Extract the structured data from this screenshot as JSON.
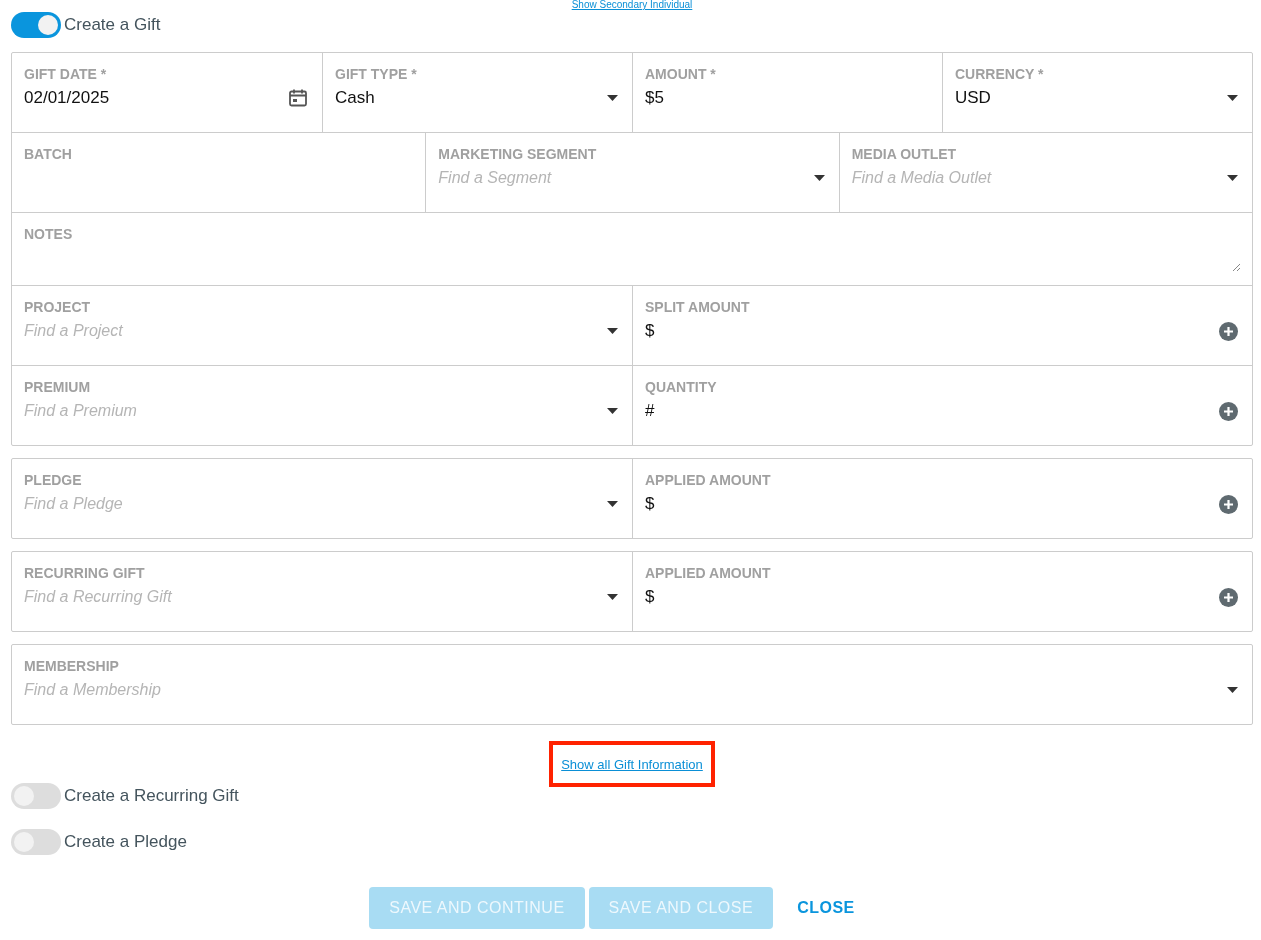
{
  "top_link": {
    "label": "Show Secondary Individual"
  },
  "create_gift": {
    "label": "Create a Gift",
    "on": true
  },
  "groups": [
    {
      "lines": [
        {
          "fields": [
            {
              "kind": "date",
              "label": "GIFT DATE *",
              "value": "02/01/2025"
            },
            {
              "kind": "select",
              "label": "GIFT TYPE *",
              "value": "Cash"
            },
            {
              "kind": "text",
              "label": "AMOUNT *",
              "value": "$5"
            },
            {
              "kind": "select",
              "label": "CURRENCY *",
              "value": "USD"
            }
          ]
        },
        {
          "fields": [
            {
              "kind": "text",
              "label": "BATCH"
            },
            {
              "kind": "select",
              "label": "MARKETING SEGMENT",
              "placeholder": "Find a Segment"
            },
            {
              "kind": "select",
              "label": "MEDIA OUTLET",
              "placeholder": "Find a Media Outlet"
            }
          ]
        },
        {
          "fields": [
            {
              "kind": "textarea",
              "label": "NOTES"
            }
          ]
        },
        {
          "fields": [
            {
              "kind": "select",
              "label": "PROJECT",
              "placeholder": "Find a Project"
            },
            {
              "kind": "add",
              "label": "SPLIT AMOUNT",
              "value": "$"
            }
          ]
        },
        {
          "fields": [
            {
              "kind": "select",
              "label": "PREMIUM",
              "placeholder": "Find a Premium"
            },
            {
              "kind": "add",
              "label": "QUANTITY",
              "value": "#"
            }
          ]
        }
      ]
    },
    {
      "lines": [
        {
          "fields": [
            {
              "kind": "select",
              "label": "PLEDGE",
              "placeholder": "Find a Pledge"
            },
            {
              "kind": "add",
              "label": "APPLIED AMOUNT",
              "value": "$"
            }
          ]
        }
      ]
    },
    {
      "lines": [
        {
          "fields": [
            {
              "kind": "select",
              "label": "RECURRING GIFT",
              "placeholder": "Find a Recurring Gift"
            },
            {
              "kind": "add",
              "label": "APPLIED AMOUNT",
              "value": "$"
            }
          ]
        }
      ]
    },
    {
      "lines": [
        {
          "fields": [
            {
              "kind": "select",
              "label": "MEMBERSHIP",
              "placeholder": "Find a Membership"
            }
          ]
        }
      ]
    }
  ],
  "show_all_link": {
    "label": "Show all Gift Information",
    "highlighted": true
  },
  "toggles": [
    {
      "label": "Create a Recurring Gift",
      "on": false
    },
    {
      "label": "Create a Pledge",
      "on": false
    }
  ],
  "buttons": [
    {
      "kind": "primary",
      "label": "SAVE AND CONTINUE",
      "disabled": true
    },
    {
      "kind": "primary",
      "label": "SAVE AND CLOSE",
      "disabled": true
    },
    {
      "kind": "flat",
      "label": "CLOSE",
      "disabled": false
    }
  ]
}
